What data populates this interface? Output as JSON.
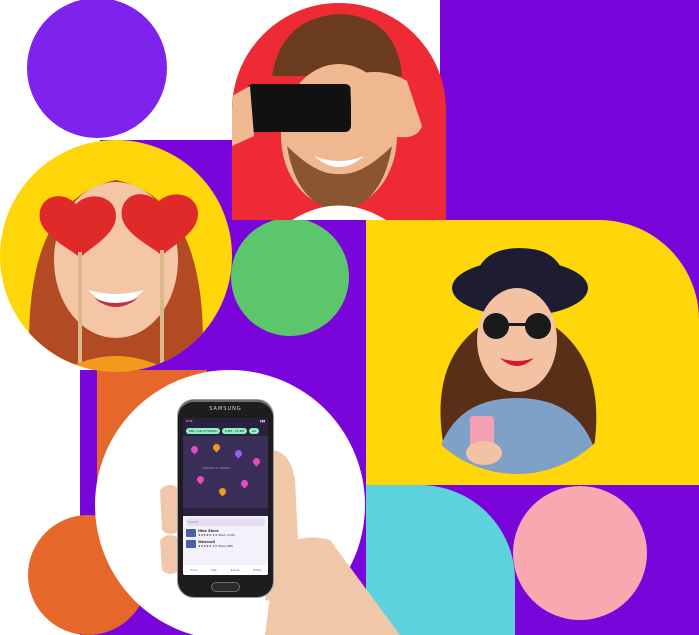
{
  "colors": {
    "purple": "#7a05db",
    "violet_circle": "#7e22ee",
    "red": "#ee2a35",
    "yellow": "#ffd60a",
    "green": "#5cc66d",
    "orange": "#e5672a",
    "cyan": "#5dd2dc",
    "pink": "#f7a8b0",
    "white": "#ffffff"
  },
  "photos": [
    {
      "name": "man-holding-phone-over-eyes-photo",
      "background": "red"
    },
    {
      "name": "woman-with-heart-glasses-photo",
      "background": "yellow"
    },
    {
      "name": "woman-with-hat-and-sunglasses-photo",
      "background": "yellow"
    },
    {
      "name": "hand-holding-phone-photo",
      "background": "white"
    }
  ],
  "phone": {
    "brand": "SAMSUNG",
    "status_time": "9:41",
    "filter_pills": [
      "Mini cost of $2000",
      "9 PM - 10 PM",
      "Go"
    ],
    "map_label": "DAMAD AL IGNAN",
    "search_placeholder": "Search",
    "listings": [
      {
        "title": "Hike Store",
        "subtitle": "★★★★★ 4.8 Stars (139)"
      },
      {
        "title": "Wearcall",
        "subtitle": "★★★★★ 4.6 Stars (88)"
      }
    ],
    "tabs": [
      "Home",
      "Map",
      "Events",
      "Profile"
    ]
  }
}
